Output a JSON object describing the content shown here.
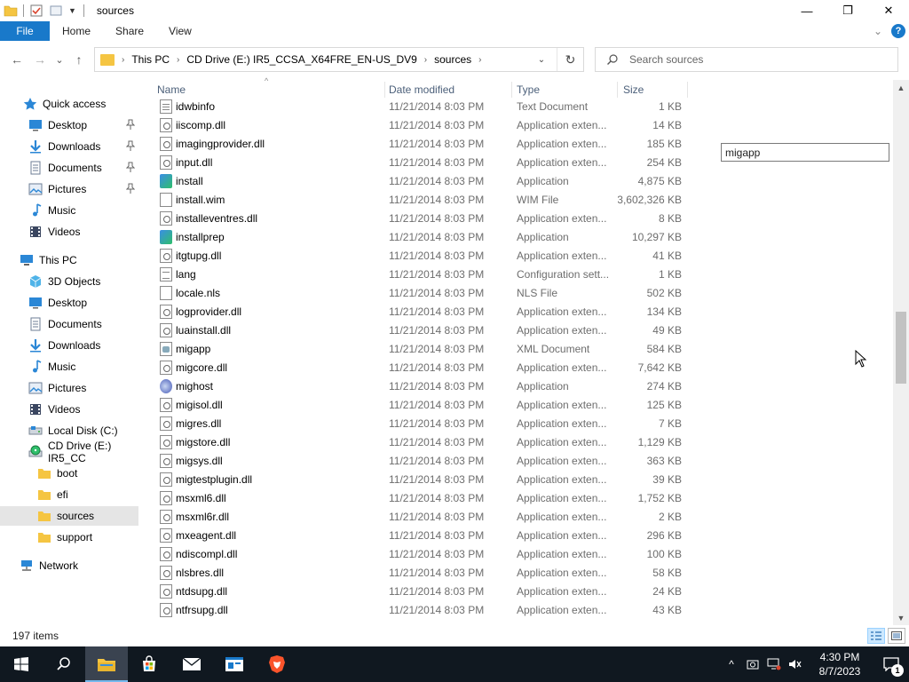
{
  "window": {
    "title": "sources",
    "minimize_glyph": "—",
    "maximize_glyph": "❐",
    "close_glyph": "✕"
  },
  "ribbon": {
    "tabs": [
      "File",
      "Home",
      "Share",
      "View"
    ],
    "help_glyph": "?",
    "expand_glyph": "⌄"
  },
  "nav": {
    "back_glyph": "←",
    "forward_glyph": "→",
    "recent_glyph": "⌄",
    "up_glyph": "↑",
    "breadcrumbs": [
      "This PC",
      "CD Drive (E:) IR5_CCSA_X64FRE_EN-US_DV9",
      "sources"
    ],
    "crumb_sep": "›",
    "dropdown_glyph": "⌄",
    "refresh_glyph": "↻",
    "search_placeholder": "Search sources"
  },
  "sidebar": {
    "items": [
      {
        "label": "Quick access",
        "icon": "star-icon",
        "pinned": false
      },
      {
        "label": "Desktop",
        "icon": "desktop-icon",
        "pinned": true
      },
      {
        "label": "Downloads",
        "icon": "downloads-icon",
        "pinned": true
      },
      {
        "label": "Documents",
        "icon": "documents-icon",
        "pinned": true
      },
      {
        "label": "Pictures",
        "icon": "pictures-icon",
        "pinned": true
      },
      {
        "label": "Music",
        "icon": "music-icon",
        "pinned": false
      },
      {
        "label": "Videos",
        "icon": "videos-icon",
        "pinned": false
      },
      {
        "label": "This PC",
        "icon": "computer-icon",
        "pinned": false
      },
      {
        "label": "3D Objects",
        "icon": "3d-objects-icon",
        "pinned": false
      },
      {
        "label": "Desktop",
        "icon": "desktop-icon",
        "pinned": false
      },
      {
        "label": "Documents",
        "icon": "documents-icon",
        "pinned": false
      },
      {
        "label": "Downloads",
        "icon": "downloads-icon",
        "pinned": false
      },
      {
        "label": "Music",
        "icon": "music-icon",
        "pinned": false
      },
      {
        "label": "Pictures",
        "icon": "pictures-icon",
        "pinned": false
      },
      {
        "label": "Videos",
        "icon": "videos-icon",
        "pinned": false
      },
      {
        "label": "Local Disk (C:)",
        "icon": "drive-icon",
        "pinned": false
      },
      {
        "label": "CD Drive (E:) IR5_CC",
        "icon": "cd-drive-icon",
        "pinned": false
      },
      {
        "label": "boot",
        "icon": "folder-icon",
        "pinned": false
      },
      {
        "label": "efi",
        "icon": "folder-icon",
        "pinned": false
      },
      {
        "label": "sources",
        "icon": "folder-icon",
        "pinned": false,
        "selected": true
      },
      {
        "label": "support",
        "icon": "folder-icon",
        "pinned": false
      },
      {
        "label": "Network",
        "icon": "network-icon",
        "pinned": false
      }
    ],
    "pin_glyph": "📌"
  },
  "columns": {
    "name": "Name",
    "date": "Date modified",
    "type": "Type",
    "size": "Size",
    "sort_glyph": "^"
  },
  "files": [
    {
      "name": "idwbinfo",
      "date": "11/21/2014 8:03 PM",
      "type": "Text Document",
      "size": "1 KB",
      "icon": "txt"
    },
    {
      "name": "iiscomp.dll",
      "date": "11/21/2014 8:03 PM",
      "type": "Application exten...",
      "size": "14 KB",
      "icon": "dll"
    },
    {
      "name": "imagingprovider.dll",
      "date": "11/21/2014 8:03 PM",
      "type": "Application exten...",
      "size": "185 KB",
      "icon": "dll"
    },
    {
      "name": "input.dll",
      "date": "11/21/2014 8:03 PM",
      "type": "Application exten...",
      "size": "254 KB",
      "icon": "dll"
    },
    {
      "name": "install",
      "date": "11/21/2014 8:03 PM",
      "type": "Application",
      "size": "4,875 KB",
      "icon": "app"
    },
    {
      "name": "install.wim",
      "date": "11/21/2014 8:03 PM",
      "type": "WIM File",
      "size": "3,602,326 KB",
      "icon": "blank"
    },
    {
      "name": "installeventres.dll",
      "date": "11/21/2014 8:03 PM",
      "type": "Application exten...",
      "size": "8 KB",
      "icon": "dll"
    },
    {
      "name": "installprep",
      "date": "11/21/2014 8:03 PM",
      "type": "Application",
      "size": "10,297 KB",
      "icon": "app"
    },
    {
      "name": "itgtupg.dll",
      "date": "11/21/2014 8:03 PM",
      "type": "Application exten...",
      "size": "41 KB",
      "icon": "dll"
    },
    {
      "name": "lang",
      "date": "11/21/2014 8:03 PM",
      "type": "Configuration sett...",
      "size": "1 KB",
      "icon": "cfg"
    },
    {
      "name": "locale.nls",
      "date": "11/21/2014 8:03 PM",
      "type": "NLS File",
      "size": "502 KB",
      "icon": "blank"
    },
    {
      "name": "logprovider.dll",
      "date": "11/21/2014 8:03 PM",
      "type": "Application exten...",
      "size": "134 KB",
      "icon": "dll"
    },
    {
      "name": "luainstall.dll",
      "date": "11/21/2014 8:03 PM",
      "type": "Application exten...",
      "size": "49 KB",
      "icon": "dll"
    },
    {
      "name": "migapp",
      "date": "11/21/2014 8:03 PM",
      "type": "XML Document",
      "size": "584 KB",
      "icon": "xml"
    },
    {
      "name": "migcore.dll",
      "date": "11/21/2014 8:03 PM",
      "type": "Application exten...",
      "size": "7,642 KB",
      "icon": "dll"
    },
    {
      "name": "mighost",
      "date": "11/21/2014 8:03 PM",
      "type": "Application",
      "size": "274 KB",
      "icon": "app2"
    },
    {
      "name": "migisol.dll",
      "date": "11/21/2014 8:03 PM",
      "type": "Application exten...",
      "size": "125 KB",
      "icon": "dll"
    },
    {
      "name": "migres.dll",
      "date": "11/21/2014 8:03 PM",
      "type": "Application exten...",
      "size": "7 KB",
      "icon": "dll"
    },
    {
      "name": "migstore.dll",
      "date": "11/21/2014 8:03 PM",
      "type": "Application exten...",
      "size": "1,129 KB",
      "icon": "dll"
    },
    {
      "name": "migsys.dll",
      "date": "11/21/2014 8:03 PM",
      "type": "Application exten...",
      "size": "363 KB",
      "icon": "dll"
    },
    {
      "name": "migtestplugin.dll",
      "date": "11/21/2014 8:03 PM",
      "type": "Application exten...",
      "size": "39 KB",
      "icon": "dll"
    },
    {
      "name": "msxml6.dll",
      "date": "11/21/2014 8:03 PM",
      "type": "Application exten...",
      "size": "1,752 KB",
      "icon": "dll"
    },
    {
      "name": "msxml6r.dll",
      "date": "11/21/2014 8:03 PM",
      "type": "Application exten...",
      "size": "2 KB",
      "icon": "dll"
    },
    {
      "name": "mxeagent.dll",
      "date": "11/21/2014 8:03 PM",
      "type": "Application exten...",
      "size": "296 KB",
      "icon": "dll"
    },
    {
      "name": "ndiscompl.dll",
      "date": "11/21/2014 8:03 PM",
      "type": "Application exten...",
      "size": "100 KB",
      "icon": "dll"
    },
    {
      "name": "nlsbres.dll",
      "date": "11/21/2014 8:03 PM",
      "type": "Application exten...",
      "size": "58 KB",
      "icon": "dll"
    },
    {
      "name": "ntdsupg.dll",
      "date": "11/21/2014 8:03 PM",
      "type": "Application exten...",
      "size": "24 KB",
      "icon": "dll"
    },
    {
      "name": "ntfrsupg.dll",
      "date": "11/21/2014 8:03 PM",
      "type": "Application exten...",
      "size": "43 KB",
      "icon": "dll"
    }
  ],
  "detail_input": {
    "value": "migapp"
  },
  "scrollbar": {
    "position_fraction": 0.42,
    "visible_fraction": 0.14,
    "up_glyph": "▲",
    "down_glyph": "▼"
  },
  "status": {
    "item_count": "197 items"
  },
  "taskbar": {
    "apps": [
      {
        "name": "start-button",
        "icon": "windows-logo-icon"
      },
      {
        "name": "search-button",
        "icon": "search-icon"
      },
      {
        "name": "file-explorer",
        "icon": "folder-icon",
        "active": true
      },
      {
        "name": "store",
        "icon": "store-icon"
      },
      {
        "name": "mail",
        "icon": "mail-icon"
      },
      {
        "name": "app-window",
        "icon": "app-window-icon"
      },
      {
        "name": "brave-browser",
        "icon": "brave-icon"
      }
    ],
    "tray_chevron": "^",
    "time": "4:30 PM",
    "date": "8/7/2023",
    "notification_count": "1"
  },
  "colors": {
    "accent": "#1979ca",
    "folder": "#f5c542",
    "taskbar": "#101820",
    "selected": "#e5e5e5",
    "brave": "#fb542b"
  }
}
